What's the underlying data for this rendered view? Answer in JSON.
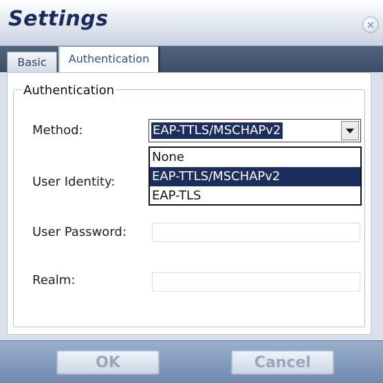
{
  "window": {
    "title": "Settings"
  },
  "close_icon_glyph": "×",
  "tabs": [
    {
      "label": "Basic",
      "active": false
    },
    {
      "label": "Authentication",
      "active": true
    }
  ],
  "group": {
    "legend": "Authentication"
  },
  "fields": {
    "method_label": "Method:",
    "method_value": "EAP-TTLS/MSCHAPv2",
    "method_options": [
      "None",
      "EAP-TTLS/MSCHAPv2",
      "EAP-TLS"
    ],
    "identity_label": "User Identity:",
    "password_label": "User Password:",
    "realm_label": "Realm:"
  },
  "buttons": {
    "ok": "OK",
    "cancel": "Cancel"
  },
  "colors": {
    "title_text": "#1a2b5e",
    "tabstrip": "#3b4c66",
    "selection": "#1c2e5e",
    "bottombar": "#6f88ad"
  }
}
